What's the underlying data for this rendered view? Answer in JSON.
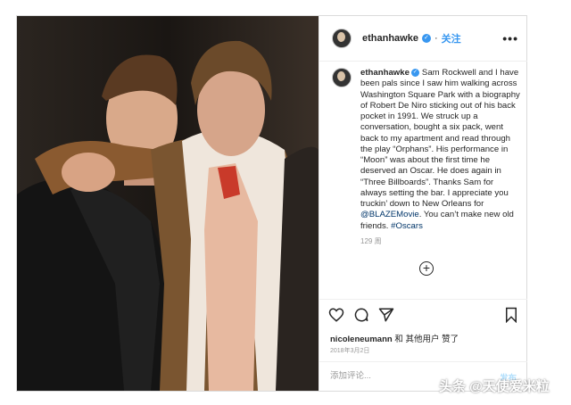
{
  "post": {
    "username": "ethanhawke",
    "follow_label": "关注",
    "more_label": "•••",
    "caption_text": "Sam Rockwell and I have been pals since I saw him walking across Washington Square Park with a biography of Robert De Niro sticking out of his back pocket in 1991. We struck up a conversation, bought a six pack, went back to my apartment and read through the play “Orphans”. His performance in “Moon” was about the first time he deserved an Oscar. He does again in “Three Billboards”. Thanks Sam for always setting the bar. I appreciate you truckin’ down to New Orleans for ",
    "caption_mention": "@BLAZEMovie",
    "caption_middle": ". You can’t make new old friends. ",
    "caption_hashtag": "#Oscars",
    "time_ago": "129 周",
    "likes_user": "nicoleneumann",
    "likes_rest": " 和 其他用户 赞了",
    "date": "2018年3月2日",
    "comment_placeholder": "添加评论...",
    "publish_label": "发布",
    "icons": [
      "heart-icon",
      "comment-icon",
      "share-icon",
      "bookmark-icon",
      "plus-circle-icon",
      "verified-icon"
    ]
  },
  "watermark": "头条 @天使爱米粒",
  "colors": {
    "accent": "#3897f0",
    "link": "#003569",
    "border": "#dbdbdb",
    "muted": "#999999"
  }
}
